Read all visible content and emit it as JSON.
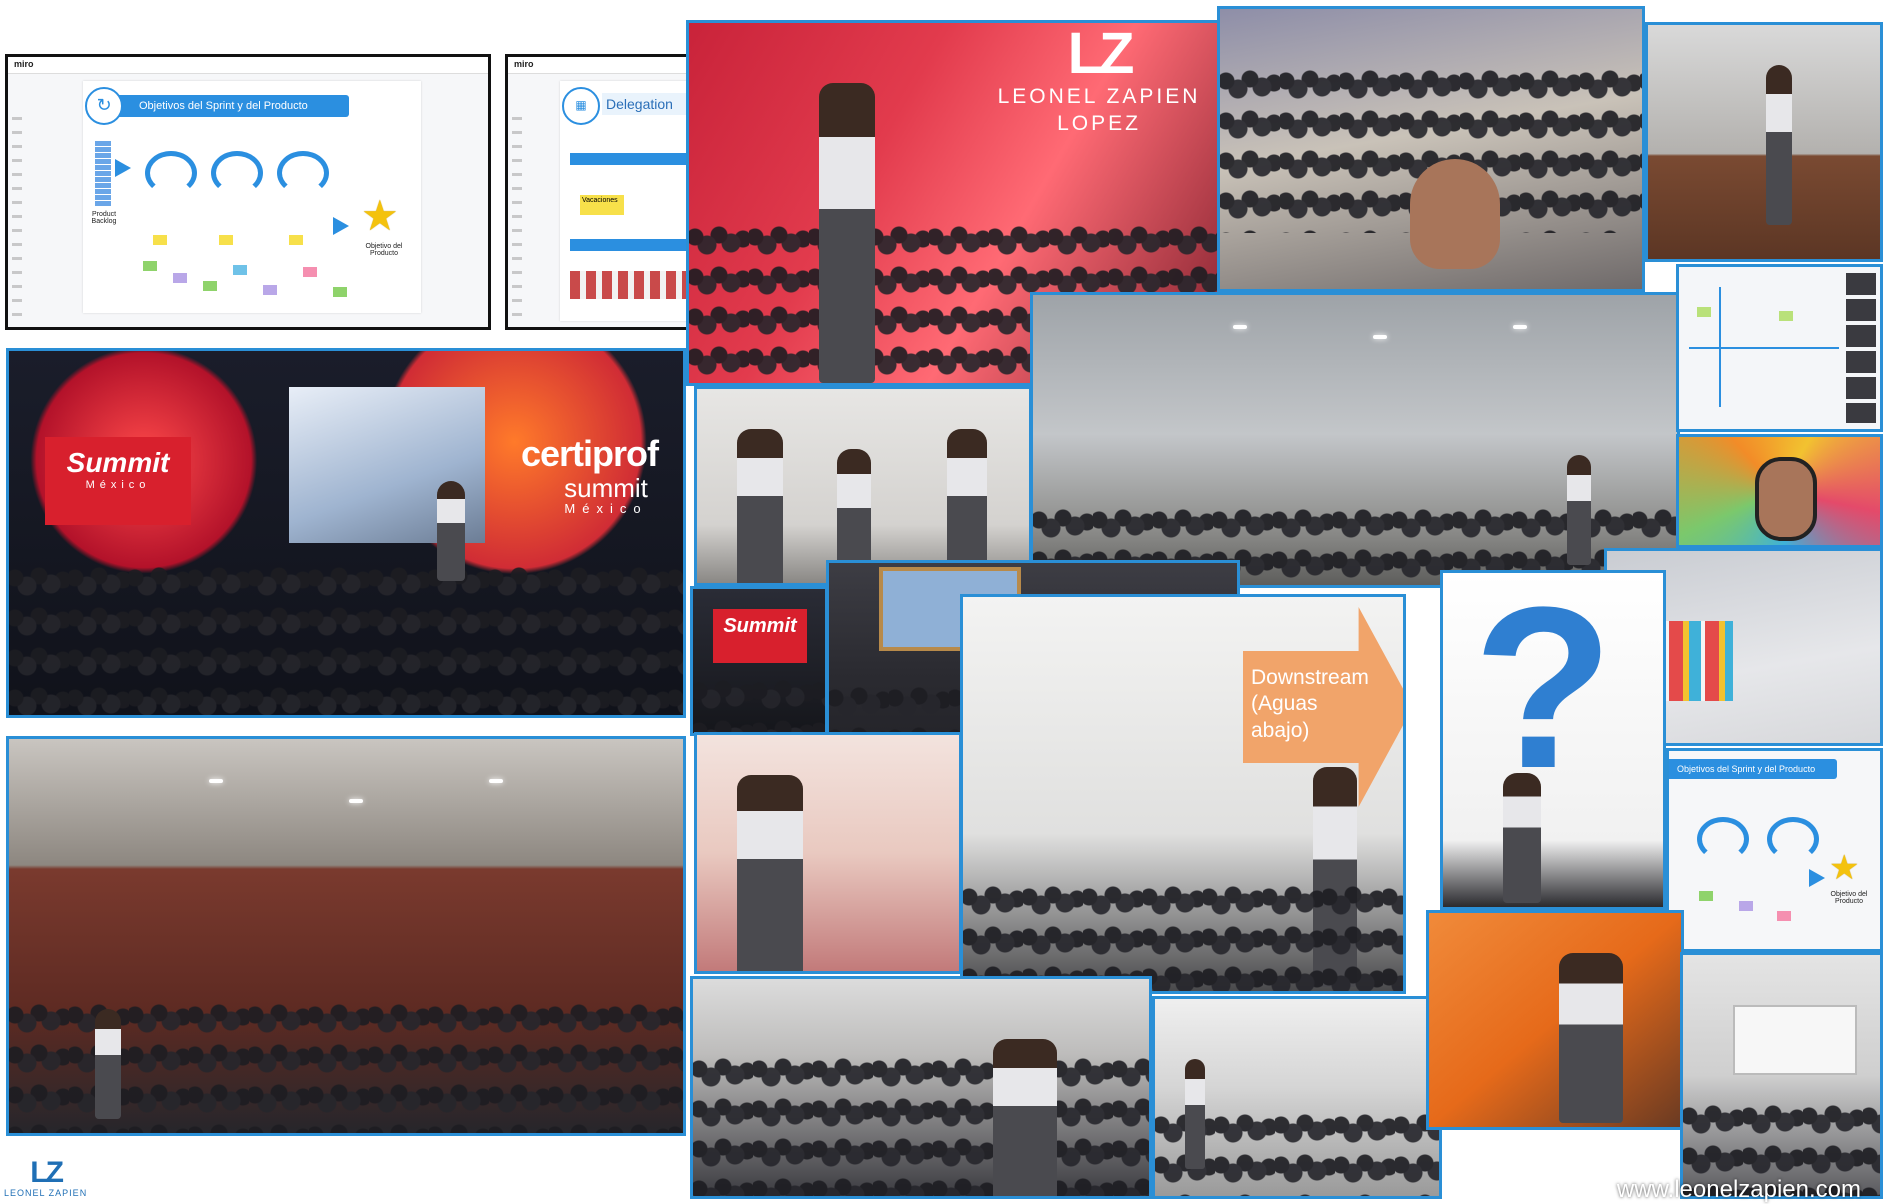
{
  "miro_board_1": {
    "app_logo": "miro",
    "title": "Objetivos del Sprint y del Producto",
    "label_backlog": "Product Backlog",
    "label_objective": "Objetivo del Producto"
  },
  "miro_board_2": {
    "app_logo": "miro",
    "title": "Delegation",
    "sticky_label": "Vacaciones"
  },
  "keynote": {
    "brand_mark": "LZ",
    "brand_line1": "LEONEL ZAPIEN",
    "brand_line2": "LOPEZ"
  },
  "certiprof": {
    "screen_text": "Summit",
    "screen_sub": "México",
    "logo": "certiprof",
    "logo_sub": "summit",
    "logo_country": "México"
  },
  "small_summit": {
    "text": "Summit"
  },
  "slide_downstream": {
    "line1": "Downstream",
    "line2": "(Aguas",
    "line3": "abajo)"
  },
  "miro_board_3": {
    "title": "Objetivos del Sprint y del Producto",
    "label_objective": "Objetivo del Producto"
  },
  "footer": {
    "logo_mark": "LZ",
    "logo_name": "LEONEL ZAPIEN",
    "website": "www.leonelzapien.com"
  },
  "colors": {
    "frame_blue": "#2a8fd6",
    "miro_blue": "#2b8fe0",
    "summit_red": "#d8202d",
    "star_yellow": "#f4c20d"
  }
}
